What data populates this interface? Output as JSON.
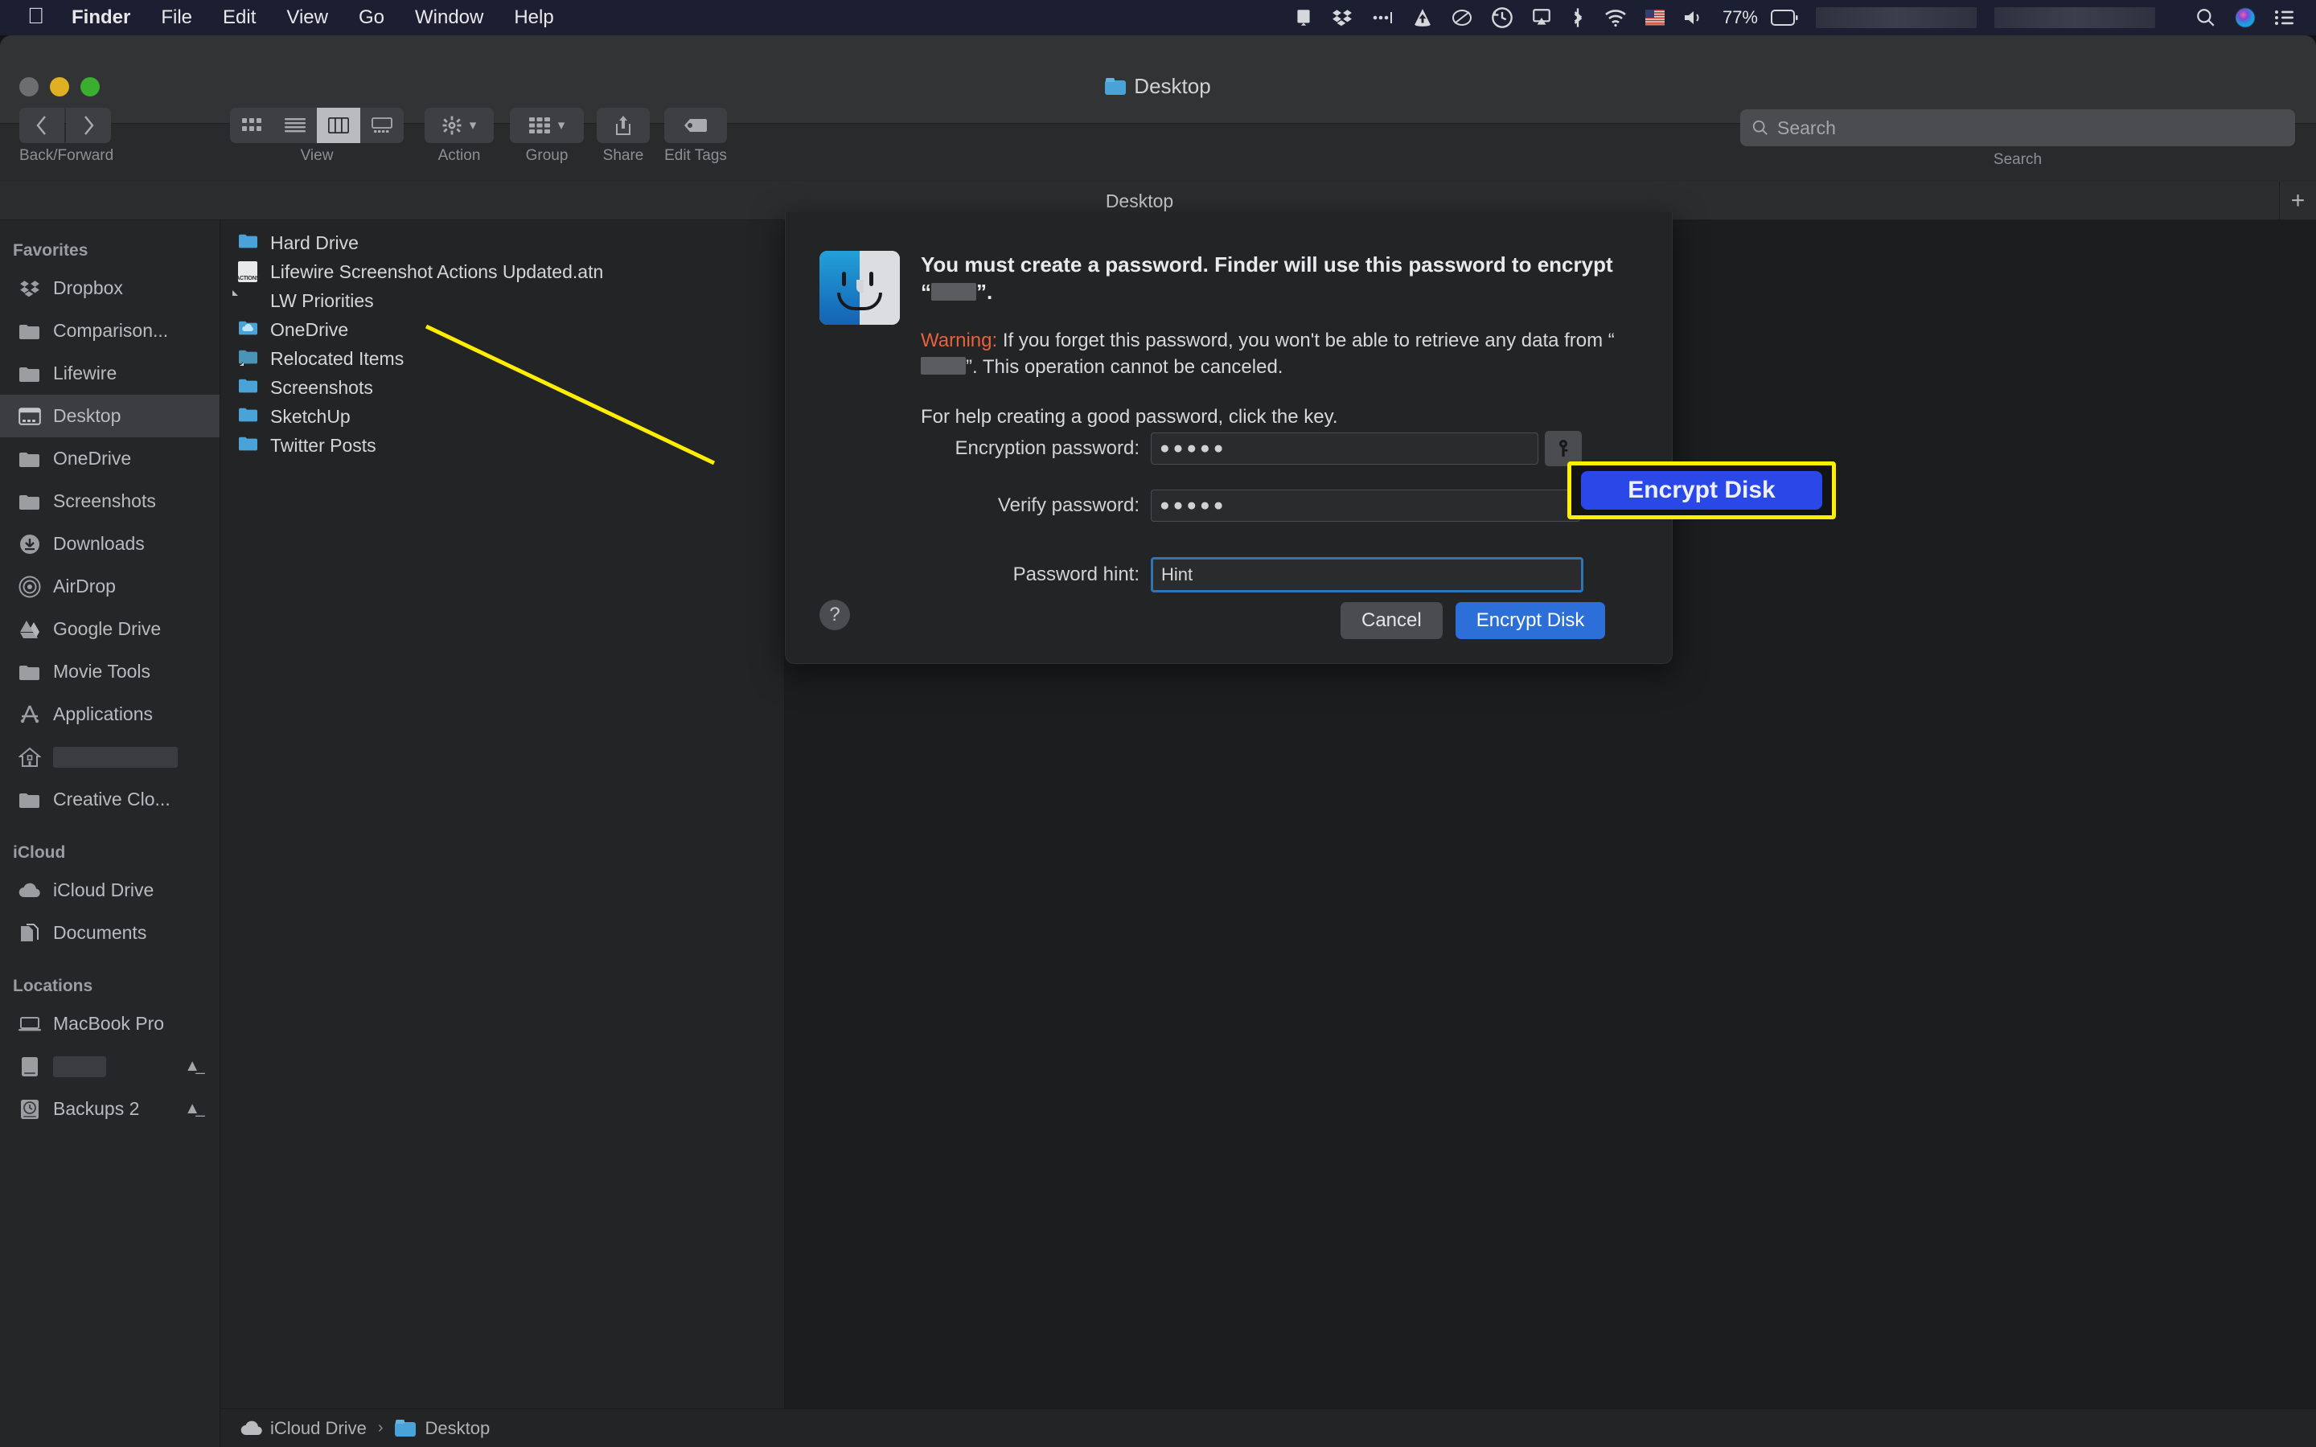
{
  "menubar": {
    "apple_icon": "apple-logo-icon",
    "items": [
      "Finder",
      "File",
      "Edit",
      "View",
      "Go",
      "Window",
      "Help"
    ],
    "status_icons": [
      "screen-mirroring-icon",
      "dropbox-icon",
      "ellipsis-icon",
      "cloud-upload-icon",
      "link-icon",
      "time-machine-icon",
      "airplay-icon",
      "bluetooth-icon",
      "wifi-icon",
      "keyboard-flag-icon",
      "volume-icon"
    ],
    "battery_percent": "77%",
    "right_icons": [
      "spotlight-search-icon",
      "siri-icon",
      "control-center-icon"
    ]
  },
  "window": {
    "title": "Desktop",
    "traffic_lights": [
      "close",
      "minimize",
      "maximize"
    ],
    "toolbar": {
      "back_forward_label": "Back/Forward",
      "view_label": "View",
      "action_label": "Action",
      "group_label": "Group",
      "share_label": "Share",
      "edit_tags_label": "Edit Tags",
      "view_modes": [
        "icon-view",
        "list-view",
        "column-view",
        "gallery-view"
      ],
      "active_view": "column-view"
    },
    "search": {
      "placeholder": "Search",
      "label": "Search",
      "value": ""
    },
    "tabbar": {
      "active_tab": "Desktop",
      "new_tab_label": "+"
    }
  },
  "sidebar": {
    "sections": [
      {
        "header": "Favorites",
        "items": [
          {
            "label": "Dropbox",
            "icon": "dropbox-icon",
            "selected": false
          },
          {
            "label": "Comparison...",
            "icon": "folder-icon",
            "selected": false
          },
          {
            "label": "Lifewire",
            "icon": "folder-icon",
            "selected": false
          },
          {
            "label": "Desktop",
            "icon": "desktop-icon",
            "selected": true
          },
          {
            "label": "OneDrive",
            "icon": "folder-icon",
            "selected": false
          },
          {
            "label": "Screenshots",
            "icon": "folder-icon",
            "selected": false
          },
          {
            "label": "Downloads",
            "icon": "downloads-icon",
            "selected": false
          },
          {
            "label": "AirDrop",
            "icon": "airdrop-icon",
            "selected": false
          },
          {
            "label": "Google Drive",
            "icon": "google-drive-icon",
            "selected": false
          },
          {
            "label": "Movie Tools",
            "icon": "folder-icon",
            "selected": false
          },
          {
            "label": "Applications",
            "icon": "applications-icon",
            "selected": false
          },
          {
            "label": "",
            "icon": "home-icon",
            "selected": false,
            "redacted": true
          },
          {
            "label": "Creative Clo...",
            "icon": "folder-icon",
            "selected": false
          }
        ]
      },
      {
        "header": "iCloud",
        "items": [
          {
            "label": "iCloud Drive",
            "icon": "cloud-icon",
            "selected": false
          },
          {
            "label": "Documents",
            "icon": "documents-icon",
            "selected": false
          }
        ]
      },
      {
        "header": "Locations",
        "items": [
          {
            "label": "MacBook Pro",
            "icon": "laptop-icon",
            "selected": false
          },
          {
            "label": "",
            "icon": "external-drive-icon",
            "selected": false,
            "redacted": true,
            "eject": true
          },
          {
            "label": "Backups 2",
            "icon": "time-machine-drive-icon",
            "selected": false,
            "eject": true
          }
        ]
      }
    ]
  },
  "filelist": {
    "items": [
      {
        "name": "Hard Drive",
        "icon": "folder-icon"
      },
      {
        "name": "Lifewire Screenshot Actions Updated.atn",
        "icon": "actions-file-icon"
      },
      {
        "name": "LW Priorities",
        "icon": "document-icon"
      },
      {
        "name": "OneDrive",
        "icon": "onedrive-folder-icon"
      },
      {
        "name": "Relocated Items",
        "icon": "alias-folder-icon"
      },
      {
        "name": "Screenshots",
        "icon": "folder-icon"
      },
      {
        "name": "SketchUp",
        "icon": "folder-icon"
      },
      {
        "name": "Twitter Posts",
        "icon": "folder-icon"
      }
    ]
  },
  "dialog": {
    "icon": "finder-face-icon",
    "heading_part1": "You must create a password. Finder will use this password to encrypt “",
    "heading_part2": "”.",
    "warning_label": "Warning:",
    "warning_part1": " If you forget this password, you won't be able to retrieve any data from “",
    "warning_part2": "”. This operation cannot be canceled.",
    "help_text": "For help creating a good password, click the key.",
    "fields": [
      {
        "label": "Encryption password:",
        "value": "●●●●●",
        "type": "password",
        "has_key_button": true
      },
      {
        "label": "Verify password:",
        "value": "●●●●●",
        "type": "password",
        "has_key_button": false
      },
      {
        "label": "Password hint:",
        "value": "Hint",
        "type": "text",
        "focused": true
      }
    ],
    "help_button": "?",
    "cancel_label": "Cancel",
    "confirm_label": "Encrypt Disk"
  },
  "callout": {
    "label": "Encrypt Disk",
    "border_color": "#ffee00",
    "button_color": "#2a47e8"
  },
  "pathbar": {
    "crumbs": [
      "iCloud Drive",
      "Desktop"
    ],
    "separator": "›"
  }
}
